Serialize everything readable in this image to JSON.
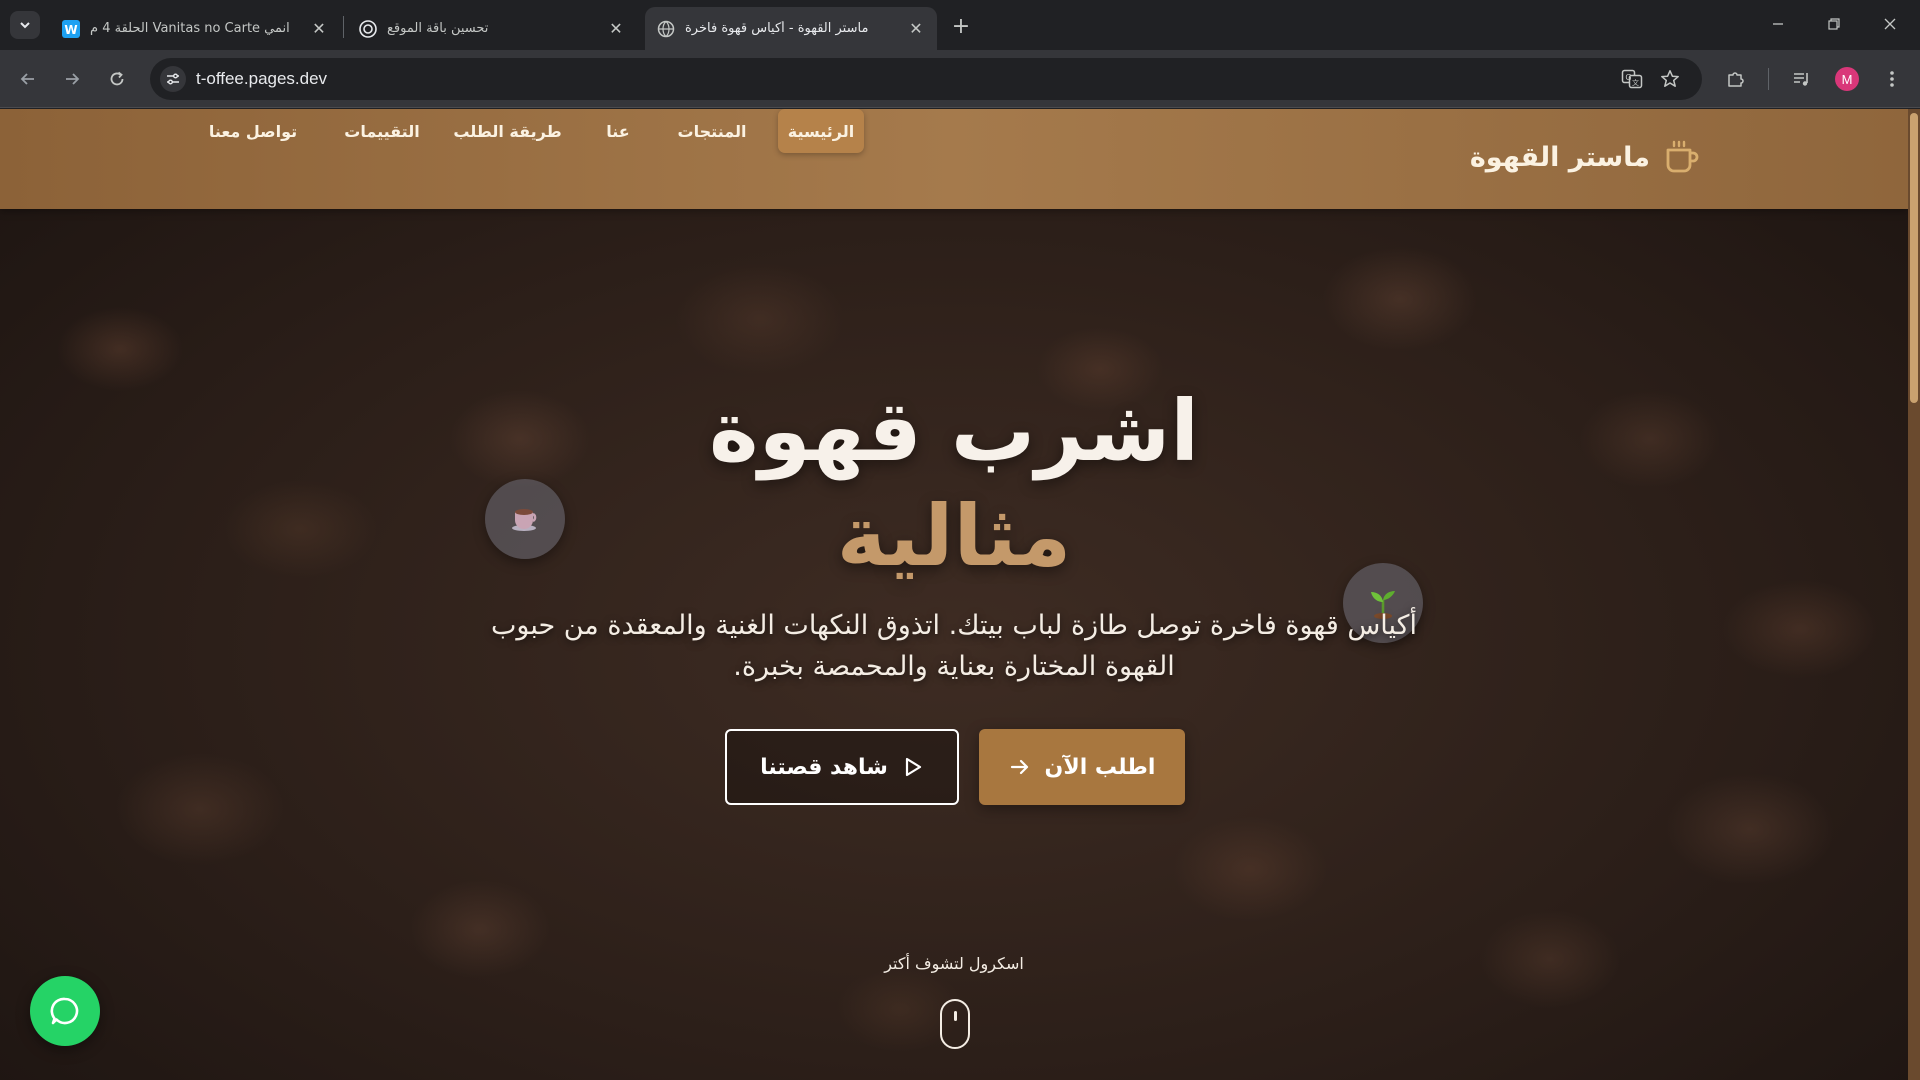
{
  "browser": {
    "tabs": [
      {
        "title": "انمي Vanitas no Carte الحلقة 4 م",
        "favicon": "w-logo-icon",
        "active": false
      },
      {
        "title": "تحسين باقة الموقع",
        "favicon": "chatgpt-icon",
        "active": false
      },
      {
        "title": "ماستر القهوة - أكياس قهوة فاخرة",
        "favicon": "globe-icon",
        "active": true
      }
    ],
    "url": "t-offee.pages.dev",
    "profile_initial": "M"
  },
  "site": {
    "logo_text": "ماستر القهوة",
    "nav": [
      {
        "label": "الرئيسية",
        "active": true
      },
      {
        "label": "المنتجات",
        "active": false
      },
      {
        "label": "عنا",
        "active": false
      },
      {
        "label": "طريقة الطلب",
        "active": false
      },
      {
        "label": "التقييمات",
        "active": false
      },
      {
        "label": "تواصل معنا",
        "active": false
      }
    ]
  },
  "hero": {
    "title_line1": "اشرب قهوة",
    "title_line2": "مثالية",
    "subtitle": "أكياس قهوة فاخرة توصل طازة لباب بيتك. اتذوق النكهات الغنية والمعقدة من حبوب القهوة المختارة بعناية والمحمصة بخبرة.",
    "primary_button": "اطلب الآن",
    "secondary_button": "شاهد قصتنا",
    "scroll_hint": "اسكرول لتشوف أكتر",
    "floating_badges": [
      "coffee-cup-icon",
      "sprout-icon"
    ]
  },
  "colors": {
    "header_brown": "#a57a4c",
    "accent_gold": "#c4996a",
    "button_brown": "#a8773f",
    "whatsapp_green": "#25d366"
  }
}
